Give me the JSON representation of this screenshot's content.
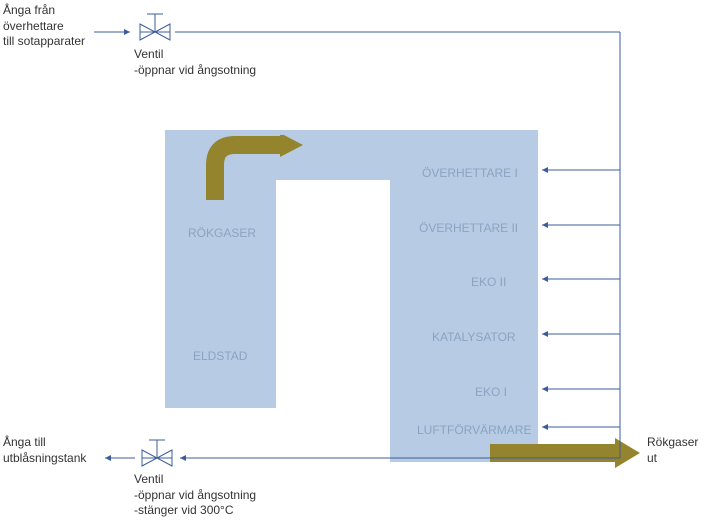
{
  "labels": {
    "topLeft1": "Ånga från",
    "topLeft2": "överhettare",
    "topLeft3": "till sotapparater",
    "valveTop1": "Ventil",
    "valveTop2": "-öppnar vid ångsotning",
    "bottomLeft1": "Ånga till",
    "bottomLeft2": "utblåsningstank",
    "valveBot1": "Ventil",
    "valveBot2": "-öppnar vid ångsotning",
    "valveBot3": "-stänger vid 300°C",
    "right1": "Rökgaser",
    "right2": "ut"
  },
  "boiler": {
    "rokgaser": "RÖKGASER",
    "eldstad": "ELDSTAD",
    "over1": "ÖVERHETTARE I",
    "over2": "ÖVERHETTARE II",
    "eko2": "EKO II",
    "katalysator": "KATALYSATOR",
    "eko1": "EKO I",
    "luft": "LUFTFÖRVÄRMARE"
  }
}
